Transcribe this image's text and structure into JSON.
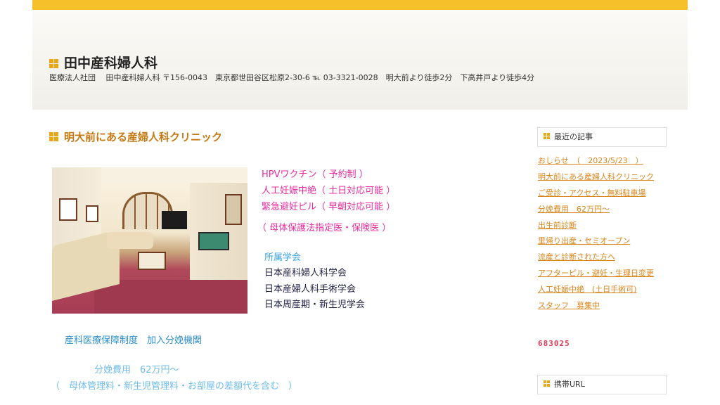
{
  "header": {
    "title": "田中産科婦人科",
    "description": "医療法人社団　 田中産科婦人科 〒156-0043　東京都世田谷区松原2-30-6 ℡ 03-3321-0028　明大前より徒歩2分　下高井戸より徒歩4分"
  },
  "main": {
    "heading": "明大前にある産婦人科クリニック",
    "services": [
      "HPVワクチン（  予約制  ）",
      "人工妊娠中絶（  土日対応可能  ）",
      "緊急避妊ピル（  早朝対応可能  ）"
    ],
    "designation": "（  母体保護法指定医・保険医  ）",
    "societies_heading": "所属学会",
    "societies": [
      "日本産科婦人科学会",
      "日本産婦人科手術学会",
      "日本周産期・新生児学会"
    ],
    "insurance": "産科医療保障制度　加入分娩機関",
    "fee": "分娩費用　62万円～",
    "fee_note": "（　母体管理料・新生児管理料・お部屋の差額代を含む　）"
  },
  "sidebar": {
    "recent_title": "最近の記事",
    "recent_links": [
      "おしらせ　（　2023/5/23　）",
      "明大前にある産婦人科クリニック",
      "ご受診・アクセス・無料駐車場",
      "分娩費用　62万円～",
      "出生前診断",
      "里帰り出産・セミオープン",
      "流産と診断された方へ",
      "アフターピル・避妊・生理日変更",
      "人工妊娠中絶　(土日手術可)",
      "スタッフ　募集中"
    ],
    "counter": "683025",
    "mobile_title": "携帯URL"
  },
  "colors": {
    "accent_bar": "#f6c02b",
    "heading": "#c47a14",
    "service_text": "#ea2c9f",
    "link": "#d9861c"
  },
  "icons": [
    "grid-bullet-icon"
  ]
}
